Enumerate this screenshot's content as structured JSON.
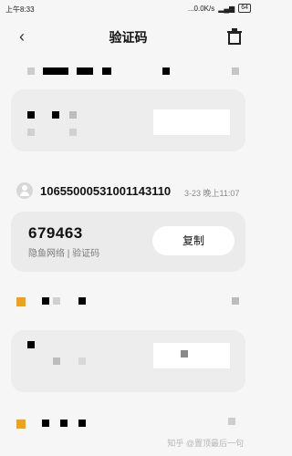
{
  "status_bar": {
    "time": "上午8:33",
    "network_speed": "...0.0K/s",
    "battery": "64"
  },
  "nav": {
    "title": "验证码",
    "back_icon": "chevron-left-icon",
    "trash_icon": "trash-icon"
  },
  "message": {
    "sender": "10655000531001143110",
    "timestamp": "3-23 晚上11:07",
    "code": "679463",
    "source": "隐鱼网络 | 验证码",
    "copy_label": "复制"
  },
  "watermark": "知乎 @置顶最后一句"
}
